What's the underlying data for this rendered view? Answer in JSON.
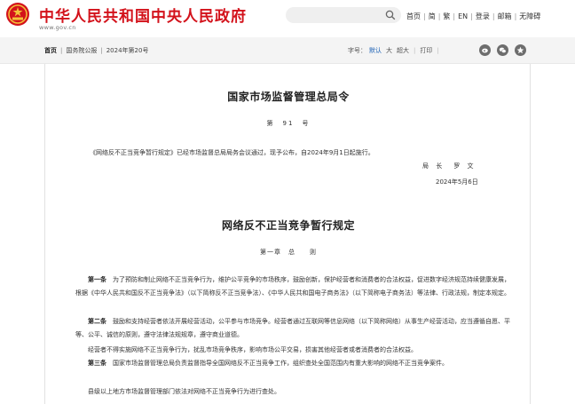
{
  "header": {
    "site_title": "中华人民共和国中央人民政府",
    "site_domain": "www.gov.cn",
    "brand_color": "#d3121b",
    "nav": [
      "首页",
      "简",
      "繁",
      "EN",
      "登录",
      "邮箱",
      "无障碍"
    ]
  },
  "breadcrumb": {
    "items": [
      "首页",
      "国务院公报",
      "2024年第20号"
    ]
  },
  "tools": {
    "font_size_label": "字号：",
    "font_default": "默认",
    "font_large": "大",
    "font_xlarge": "超大",
    "print_label": "打印"
  },
  "document": {
    "order_title": "国家市场监督管理总局令",
    "order_number": "第　91　号",
    "intro": "《网络反不正当竞争暂行规定》已经市场监督总局局务会议通过，现予公布，自2024年9月1日起施行。",
    "signer": "局 长　罗 文",
    "date": "2024年5月6日",
    "reg_title": "网络反不正当竞争暂行规定",
    "chapter": "第一章　总　　则",
    "paragraphs": [
      {
        "article": "第一条",
        "text": "　为了预防和制止网络不正当竞争行为，维护公平竞争的市场秩序，鼓励创新，保护经营者和消费者的合法权益，促进数字经济规范持续健康发展，根据《中华人民共和国反不正当竞争法》（以下简称反不正当竞争法）、《中华人民共和国电子商务法》（以下简称电子商务法）等法律、行政法规，制定本规定。"
      },
      {
        "article": "第二条",
        "text": "　鼓励和支持经营者依法开展经营活动，公平参与市场竞争。经营者通过互联网等信息网络（以下简称网络）从事生产经营活动，应当遵循自愿、平等、公平、诚信的原则，遵守法律法规规章，遵守商业道德。"
      },
      {
        "article": "",
        "text": "经营者不得实施网络不正当竞争行为，扰乱市场竞争秩序，影响市场公平交易，损害其他经营者或者消费者的合法权益。"
      },
      {
        "article": "第三条",
        "text": "　国家市场监督管理总局负责监督指导全国网络反不正当竞争工作，组织查处全国范围内有重大影响的网络不正当竞争案件。"
      },
      {
        "article": "",
        "text": "县级以上地方市场监督管理部门依法对网络不正当竞争行为进行查处。"
      }
    ]
  },
  "icons": [
    "emblem-icon",
    "search-icon",
    "wechat-icon",
    "weibo-icon",
    "qzone-icon"
  ]
}
